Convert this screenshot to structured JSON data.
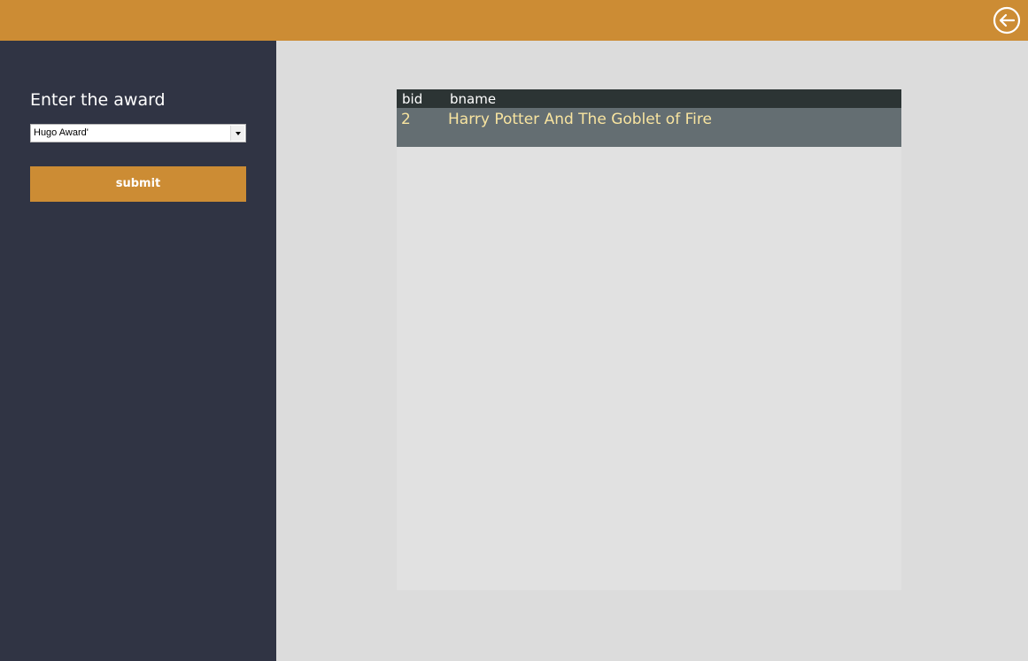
{
  "header": {
    "back_icon": "back-arrow-circle-icon"
  },
  "sidebar": {
    "title": "Enter the award",
    "award_select": {
      "selected": "Hugo Award'"
    },
    "submit_label": "submit"
  },
  "table": {
    "columns": [
      "bid",
      "bname"
    ],
    "rows": [
      {
        "bid": "2",
        "bname": "Harry Potter And The Goblet of Fire"
      }
    ]
  },
  "colors": {
    "accent": "#cc8c34",
    "sidebar_bg": "#303444",
    "header_bg": "#2c3434",
    "row_bg": "#646e72",
    "row_text": "#f8e4a0"
  }
}
